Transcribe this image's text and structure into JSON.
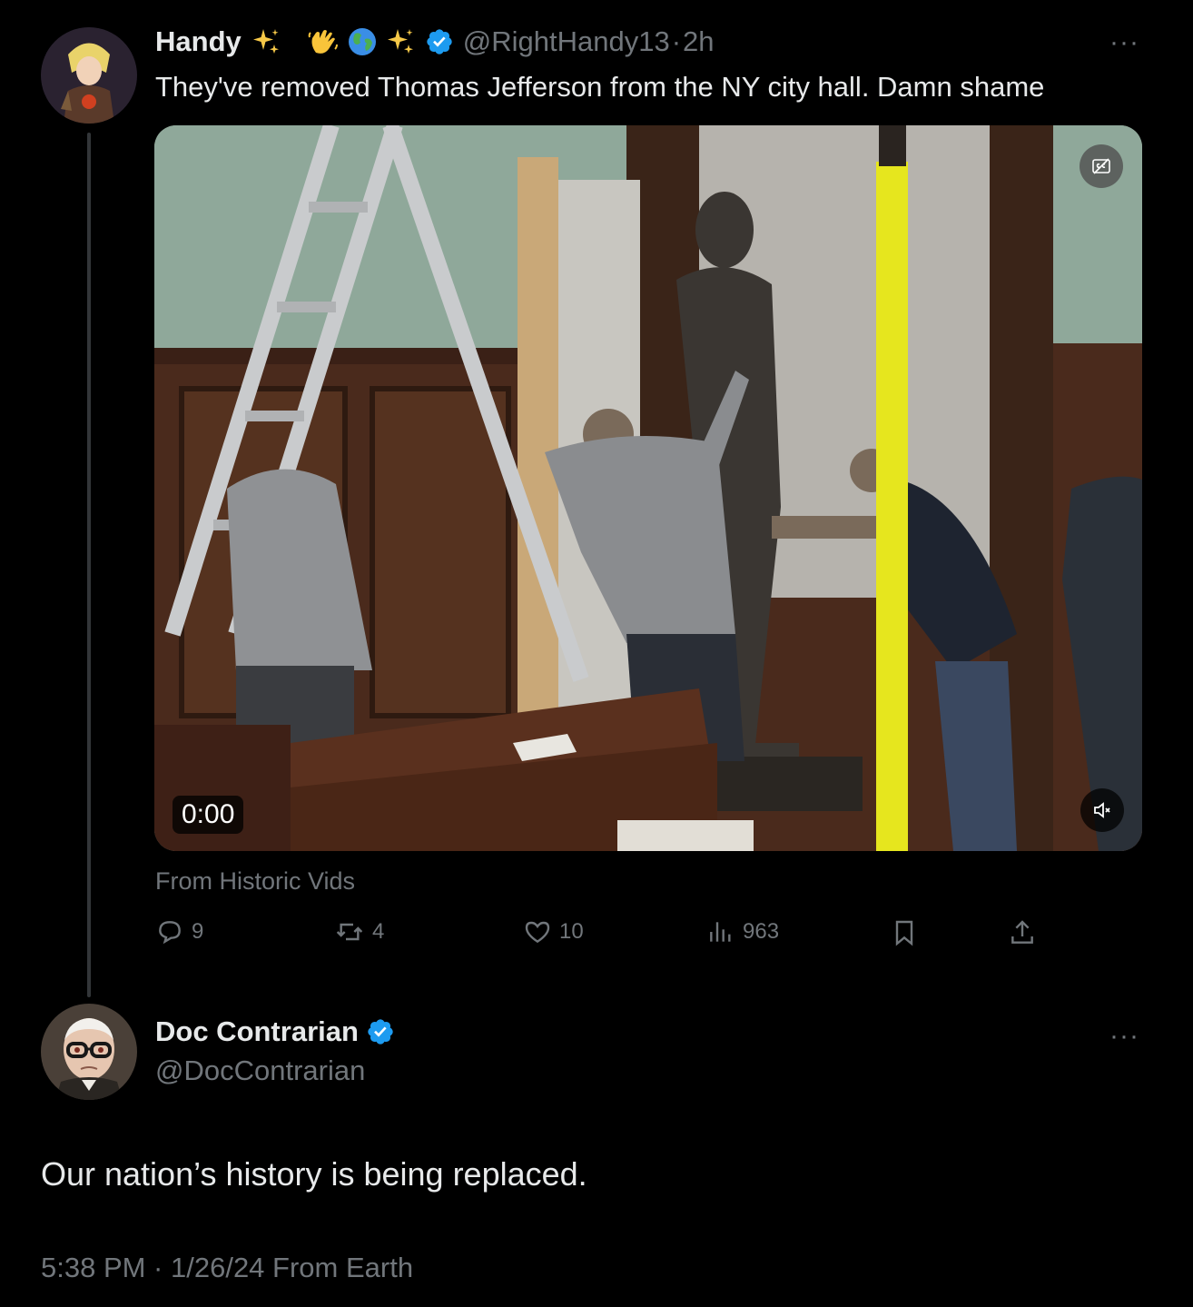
{
  "tweet": {
    "author_name": "Handy",
    "author_emojis": [
      "sparkles-emoji",
      "waving-hand-emoji",
      "globe-emoji",
      "sparkles-emoji"
    ],
    "handle": "@RightHandy13",
    "separator": "·",
    "time": "2h",
    "text": "They've removed Thomas Jefferson from the NY city hall. Damn shame",
    "video": {
      "timecode": "0:00",
      "cc_icon": "captions-off-icon",
      "mute_icon": "volume-muted-icon"
    },
    "source": "From Historic Vids",
    "actions": {
      "replies": "9",
      "reposts": "4",
      "likes": "10",
      "views": "963"
    }
  },
  "reply": {
    "author_name": "Doc Contrarian",
    "handle": "@DocContrarian",
    "text": "Our nation’s history is being replaced.",
    "timestamp": "5:38 PM · 1/26/24 From Earth"
  },
  "colors": {
    "background": "#000000",
    "text": "#e7e9ea",
    "muted": "#71767b",
    "verified": "#1d9bf0",
    "thread_line": "#333639"
  },
  "more_label": "···"
}
